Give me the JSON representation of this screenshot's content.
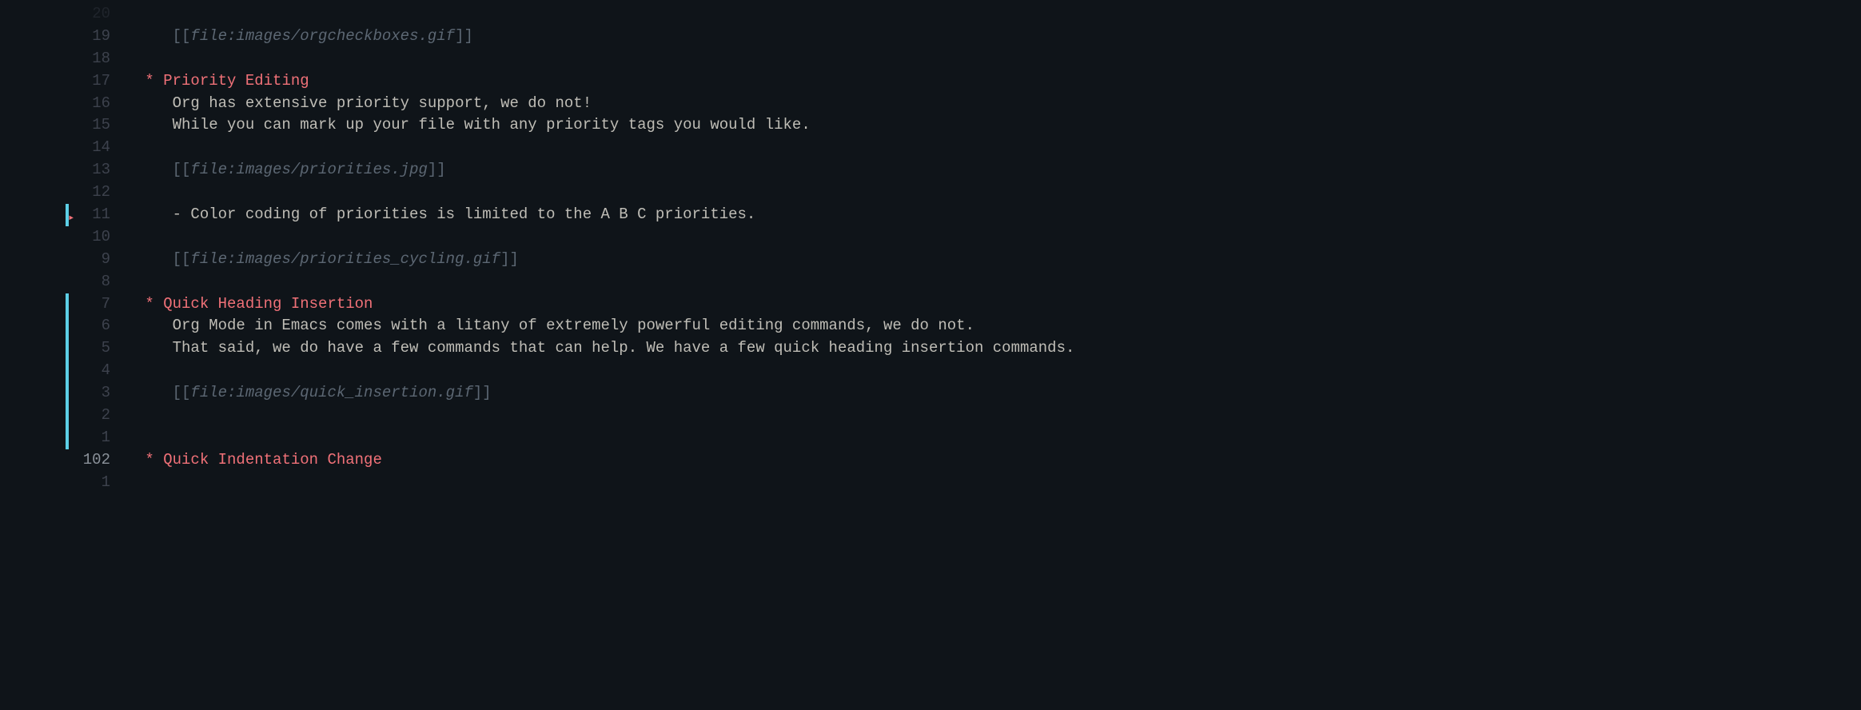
{
  "colors": {
    "bg": "#0f1419",
    "gutter": "#3d424d",
    "gutter_current": "#8a9199",
    "link": "#5c6773",
    "heading": "#f07178",
    "text": "#bfbdb6",
    "mark": "#5ccfe6"
  },
  "lines": [
    {
      "num": "20",
      "dim": true,
      "segments": []
    },
    {
      "num": "19",
      "segments": [
        {
          "t": "    ",
          "c": "plain"
        },
        {
          "t": "[[",
          "c": "link-bracket"
        },
        {
          "t": "file:images/orgcheckboxes.gif",
          "c": "link-text"
        },
        {
          "t": "]]",
          "c": "link-bracket"
        }
      ]
    },
    {
      "num": "18",
      "segments": []
    },
    {
      "num": "17",
      "segments": [
        {
          "t": " ",
          "c": "plain"
        },
        {
          "t": "*",
          "c": "star"
        },
        {
          "t": " ",
          "c": "plain"
        },
        {
          "t": "Priority Editing",
          "c": "heading"
        }
      ]
    },
    {
      "num": "16",
      "segments": [
        {
          "t": "    Org has extensive priority support, we do not!",
          "c": "plain"
        }
      ]
    },
    {
      "num": "15",
      "segments": [
        {
          "t": "    While you can mark up your file with any priority tags you would like.",
          "c": "plain"
        }
      ]
    },
    {
      "num": "14",
      "segments": []
    },
    {
      "num": "13",
      "segments": [
        {
          "t": "    ",
          "c": "plain"
        },
        {
          "t": "[[",
          "c": "link-bracket"
        },
        {
          "t": "file:images/priorities.jpg",
          "c": "link-text"
        },
        {
          "t": "]]",
          "c": "link-bracket"
        }
      ]
    },
    {
      "num": "12",
      "segments": []
    },
    {
      "num": "11",
      "segments": [
        {
          "t": "    - Color coding of priorities is limited to the A B C priorities.",
          "c": "plain"
        }
      ]
    },
    {
      "num": "10",
      "segments": []
    },
    {
      "num": "9",
      "segments": [
        {
          "t": "    ",
          "c": "plain"
        },
        {
          "t": "[[",
          "c": "link-bracket"
        },
        {
          "t": "file:images/priorities_cycling.gif",
          "c": "link-text"
        },
        {
          "t": "]]",
          "c": "link-bracket"
        }
      ]
    },
    {
      "num": "8",
      "segments": []
    },
    {
      "num": "7",
      "segments": [
        {
          "t": " ",
          "c": "plain"
        },
        {
          "t": "*",
          "c": "star"
        },
        {
          "t": " ",
          "c": "plain"
        },
        {
          "t": "Quick Heading Insertion",
          "c": "heading"
        }
      ]
    },
    {
      "num": "6",
      "segments": [
        {
          "t": "    Org Mode in Emacs comes with a litany of extremely powerful editing commands, we do not.",
          "c": "plain"
        }
      ]
    },
    {
      "num": "5",
      "segments": [
        {
          "t": "    That said, we do have a few commands that can help. We have a few quick heading insertion commands.",
          "c": "plain"
        }
      ]
    },
    {
      "num": "4",
      "segments": []
    },
    {
      "num": "3",
      "segments": [
        {
          "t": "    ",
          "c": "plain"
        },
        {
          "t": "[[",
          "c": "link-bracket"
        },
        {
          "t": "file:images/quick_insertion.gif",
          "c": "link-text"
        },
        {
          "t": "]]",
          "c": "link-bracket"
        }
      ]
    },
    {
      "num": "2",
      "segments": []
    },
    {
      "num": "1",
      "segments": []
    },
    {
      "num": "102",
      "current": true,
      "segments": [
        {
          "t": " ",
          "c": "plain"
        },
        {
          "t": "*",
          "c": "star"
        },
        {
          "t": " ",
          "c": "plain"
        },
        {
          "t": "Quick Indentation Change",
          "c": "heading"
        }
      ]
    },
    {
      "num": "1",
      "segments": []
    }
  ],
  "marks": [
    {
      "row": 9,
      "type": "blue"
    },
    {
      "row": 9,
      "type": "red"
    },
    {
      "row": 13,
      "type": "blue-long",
      "span": 7
    }
  ]
}
